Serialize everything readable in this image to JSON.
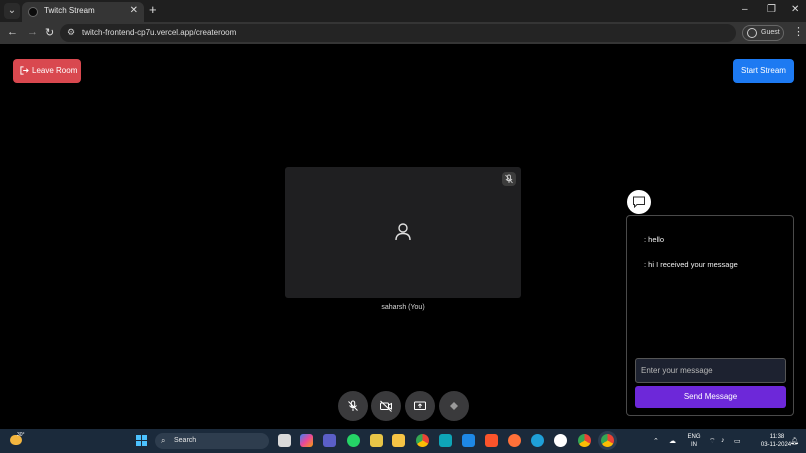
{
  "browser": {
    "tab_title": "Twitch Stream",
    "tab_close": "✕",
    "new_tab": "+",
    "url": "twitch-frontend-cp7u.vercel.app/createroom",
    "profile_label": "Guest"
  },
  "room": {
    "leave_label": "Leave Room",
    "start_stream_label": "Start Stream",
    "participant_name": "saharsh (You)"
  },
  "chat": {
    "messages": [
      ": hello",
      ": hi I received your message"
    ],
    "input_placeholder": "Enter your message",
    "send_label": "Send Message"
  },
  "taskbar": {
    "weather_temp": "30°",
    "search_label": "Search",
    "language_top": "ENG",
    "language_bottom": "IN",
    "time": "11:38",
    "date": "03-11-2024"
  },
  "colors": {
    "leave_button": "#d9484f",
    "start_button": "#1d7af2",
    "send_button": "#6d28d9",
    "tile_background": "#1f1f21"
  },
  "icons": [
    "exit-icon",
    "mic-off-icon",
    "camera-off-icon",
    "screen-share-icon",
    "diamond-icon",
    "chat-bubble-icon",
    "user-icon"
  ]
}
